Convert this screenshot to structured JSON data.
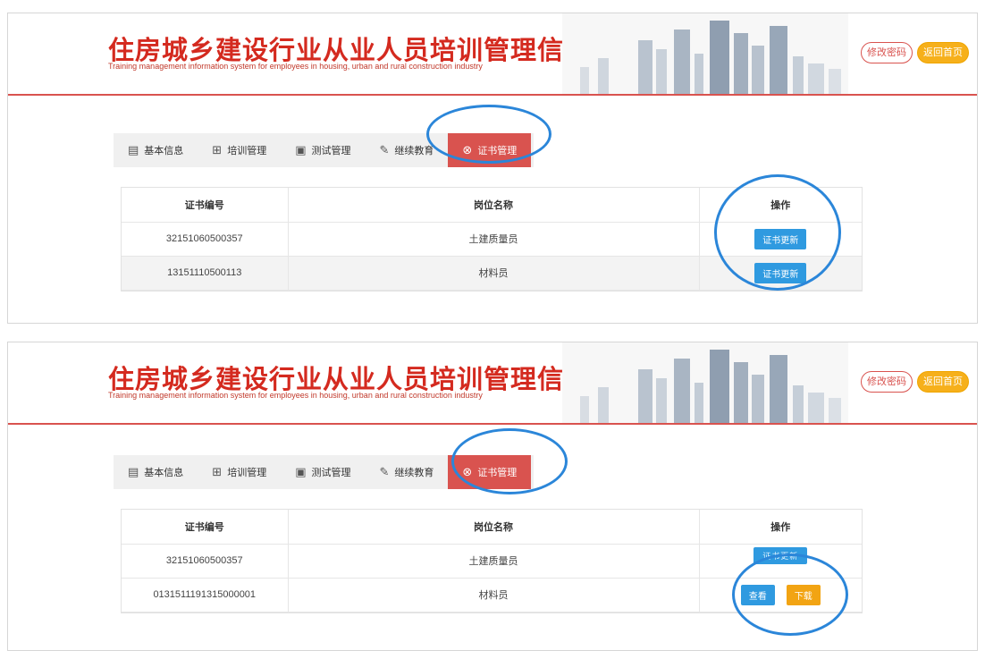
{
  "panels": [
    {
      "header": {
        "title_cn": "住房城乡建设行业从业人员培训管理信息系统",
        "title_en": "Training management information system for employees in housing, urban and rural construction industry",
        "btn_change_password": "修改密码",
        "btn_return_home": "返回首页"
      },
      "tabs": [
        {
          "label": "基本信息",
          "icon": "clipboard-icon"
        },
        {
          "label": "培训管理",
          "icon": "training-icon"
        },
        {
          "label": "测试管理",
          "icon": "test-icon"
        },
        {
          "label": "继续教育",
          "icon": "edit-icon"
        },
        {
          "label": "证书管理",
          "icon": "certificate-icon",
          "active": true
        }
      ],
      "table": {
        "headers": [
          "证书编号",
          "岗位名称",
          "操作"
        ],
        "rows": [
          {
            "cert_no": "32151060500357",
            "position": "土建质量员",
            "action": "证书更新"
          },
          {
            "cert_no": "13151110500113",
            "position": "材料员",
            "action": "证书更新"
          }
        ]
      }
    },
    {
      "header": {
        "title_cn": "住房城乡建设行业从业人员培训管理信息系统",
        "title_en": "Training management information system for employees in housing, urban and rural construction industry",
        "btn_change_password": "修改密码",
        "btn_return_home": "返回首页"
      },
      "tabs": [
        {
          "label": "基本信息",
          "icon": "clipboard-icon"
        },
        {
          "label": "培训管理",
          "icon": "training-icon"
        },
        {
          "label": "测试管理",
          "icon": "test-icon"
        },
        {
          "label": "继续教育",
          "icon": "edit-icon"
        },
        {
          "label": "证书管理",
          "icon": "certificate-icon",
          "active": true
        }
      ],
      "table": {
        "headers": [
          "证书编号",
          "岗位名称",
          "操作"
        ],
        "rows": [
          {
            "cert_no": "32151060500357",
            "position": "土建质量员",
            "action": "证书更新"
          },
          {
            "cert_no": "0131511191315000001",
            "position": "材料员",
            "action_view": "查看",
            "action_download": "下载"
          }
        ]
      }
    }
  ],
  "colors": {
    "brand_red": "#d42a1f",
    "active_tab": "#d9534f",
    "button_blue": "#2f9ae0",
    "button_orange": "#f2a413",
    "annotation_circle": "#2b86d9"
  }
}
